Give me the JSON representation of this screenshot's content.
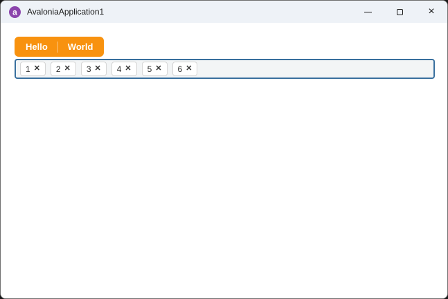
{
  "window": {
    "title": "AvaloniaApplication1",
    "controls": {
      "minimize_label": "minimize",
      "maximize_label": "maximize",
      "close_glyph": "×"
    }
  },
  "logo": {
    "glyph": "a"
  },
  "tabs": [
    {
      "label": "Hello"
    },
    {
      "label": "World"
    }
  ],
  "chips": [
    {
      "label": "1"
    },
    {
      "label": "2"
    },
    {
      "label": "3"
    },
    {
      "label": "4"
    },
    {
      "label": "5"
    },
    {
      "label": "6"
    }
  ],
  "icons": {
    "chip_remove": "✕"
  },
  "colors": {
    "accent_orange": "#F8920F",
    "focus_border": "#386F9E",
    "logo_purple": "#8B44AC",
    "titlebar_bg": "#EEF2F7"
  }
}
